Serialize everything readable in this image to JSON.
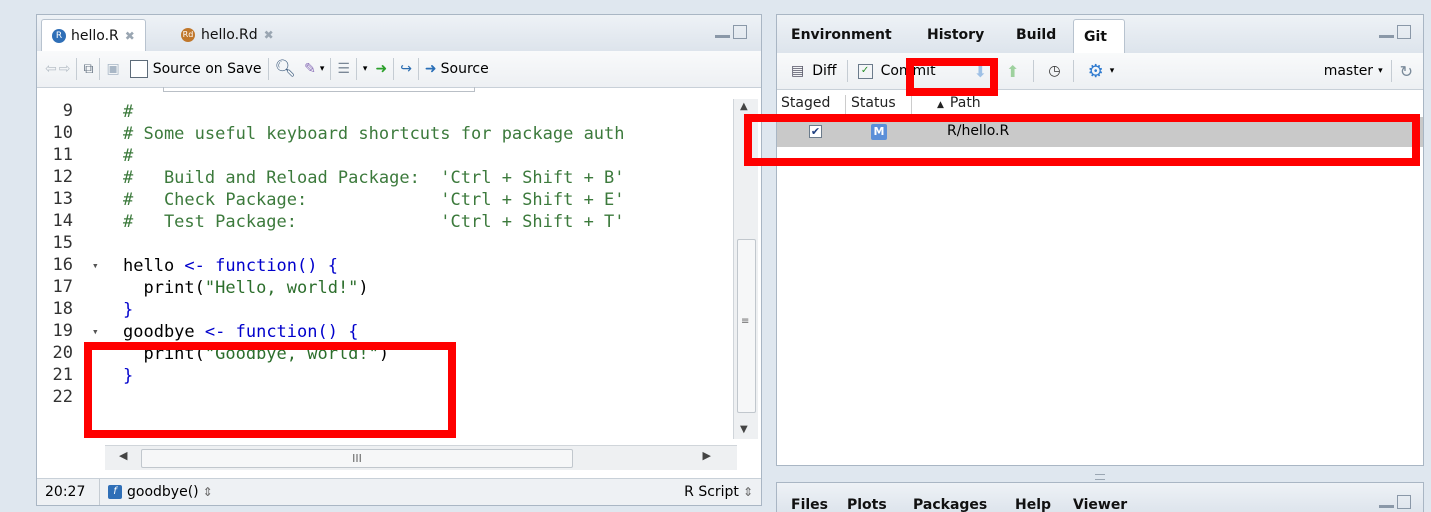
{
  "editor": {
    "tabs": [
      "hello.R",
      "hello.Rd"
    ],
    "toolbar": {
      "source_on_save": "Source on Save",
      "source": "Source"
    },
    "line_numbers": [
      "9",
      "10",
      "11",
      "12",
      "13",
      "14",
      "15",
      "16",
      "17",
      "18",
      "19",
      "20",
      "21",
      "22"
    ],
    "lines": [
      [
        {
          "t": "#",
          "c": "cm"
        }
      ],
      [
        {
          "t": "# Some useful keyboard shortcuts for package auth",
          "c": "cm"
        }
      ],
      [
        {
          "t": "#",
          "c": "cm"
        }
      ],
      [
        {
          "t": "#   Build and Reload Package:  'Ctrl + Shift + B'",
          "c": "cm"
        }
      ],
      [
        {
          "t": "#   Check Package:             'Ctrl + Shift + E'",
          "c": "cm"
        }
      ],
      [
        {
          "t": "#   Test Package:              'Ctrl + Shift + T'",
          "c": "cm"
        }
      ],
      [],
      [
        {
          "t": "hello ",
          "c": "id"
        },
        {
          "t": "<- ",
          "c": "kw"
        },
        {
          "t": "function",
          "c": "kw"
        },
        {
          "t": "() {",
          "c": "kw"
        }
      ],
      [
        {
          "t": "  print(",
          "c": "id"
        },
        {
          "t": "\"Hello, world!\"",
          "c": "st"
        },
        {
          "t": ")",
          "c": "id"
        }
      ],
      [
        {
          "t": "}",
          "c": "kw"
        }
      ],
      [
        {
          "t": "goodbye ",
          "c": "id"
        },
        {
          "t": "<- ",
          "c": "kw"
        },
        {
          "t": "function",
          "c": "kw"
        },
        {
          "t": "() {",
          "c": "kw"
        }
      ],
      [
        {
          "t": "  print(",
          "c": "id"
        },
        {
          "t": "\"Goodbye, world!\"",
          "c": "st"
        },
        {
          "t": ")",
          "c": "id"
        }
      ],
      [
        {
          "t": "}",
          "c": "kw"
        }
      ],
      []
    ],
    "fold_lines": [
      7,
      10
    ],
    "hscroll_glyph": "III",
    "status": {
      "position": "20:27",
      "function": "goodbye()",
      "filetype": "R Script"
    }
  },
  "git_pane": {
    "tabs": [
      "Environment",
      "History",
      "Build",
      "Git"
    ],
    "active_tab": "Git",
    "toolbar": {
      "diff": "Diff",
      "commit": "Commit",
      "branch": "master"
    },
    "columns": {
      "staged": "Staged",
      "status": "Status",
      "path": "Path"
    },
    "rows": [
      {
        "staged": true,
        "status": "M",
        "path": "R/hello.R"
      }
    ]
  },
  "lower_pane": {
    "tabs": [
      "Files",
      "Plots",
      "Packages",
      "Help",
      "Viewer"
    ]
  },
  "colors": {
    "highlight": "#ff0000",
    "selected_row": "#c9c9c9"
  }
}
